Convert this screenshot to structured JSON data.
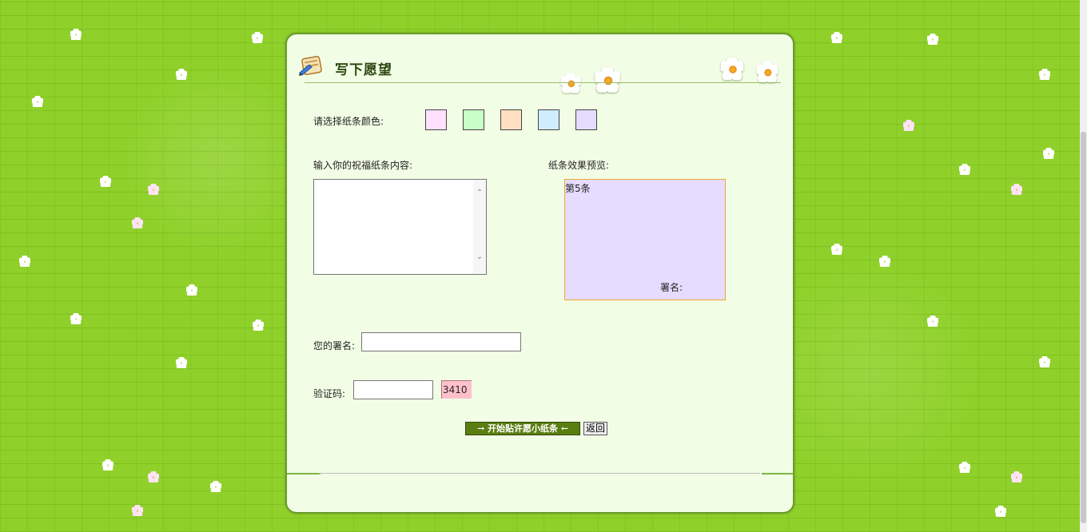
{
  "form": {
    "title": "写下愿望",
    "color_label": "请选择纸条颜色:",
    "swatch_colors": [
      "#ffe0ff",
      "#c8ffc8",
      "#ffe0c0",
      "#d0ecff",
      "#e5dcff"
    ],
    "content_label": "输入你的祝福纸条内容:",
    "content_value": "",
    "preview_label": "纸条效果预览:",
    "preview_number": "第5条",
    "preview_signature": "署名:",
    "preview_color": "#e5dcff",
    "signature_label": "您的署名:",
    "signature_value": "",
    "captcha_label": "验证码:",
    "captcha_value": "",
    "captcha_code": "3410",
    "submit_label": "→ 开始贴许愿小纸条 ←",
    "back_label": "返回"
  }
}
